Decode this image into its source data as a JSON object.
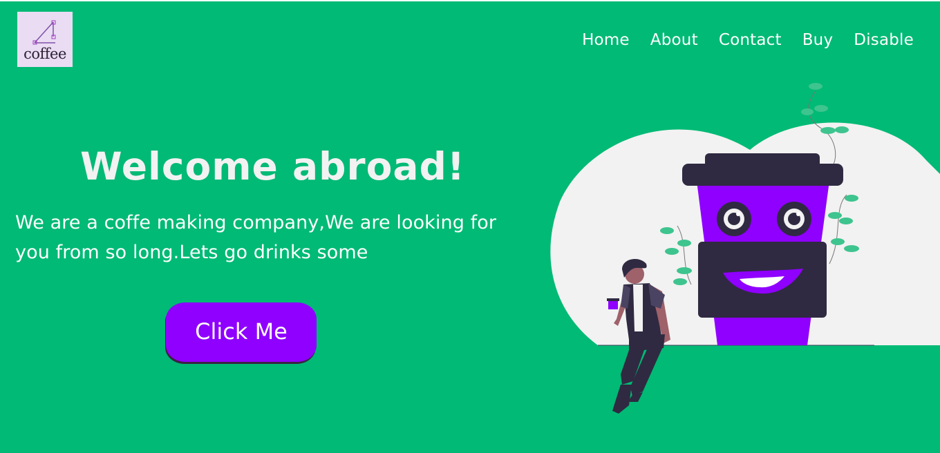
{
  "brand": {
    "logo_text": "coffee",
    "logo_icon": "network-node-icon"
  },
  "nav": {
    "items": [
      {
        "label": "Home"
      },
      {
        "label": "About"
      },
      {
        "label": "Contact"
      },
      {
        "label": "Buy"
      },
      {
        "label": "Disable"
      }
    ]
  },
  "hero": {
    "title": "Welcome abroad!",
    "description": "We are a coffe making company,We are looking for you from so long.Lets go drinks some",
    "cta_label": "Click Me"
  },
  "colors": {
    "background": "#00ba75",
    "accent": "#8f00ff",
    "logo_bg": "#eadcf3",
    "text_light": "#ffffff"
  },
  "illustration": {
    "name": "coffee-cup-character-with-person-illustration"
  }
}
